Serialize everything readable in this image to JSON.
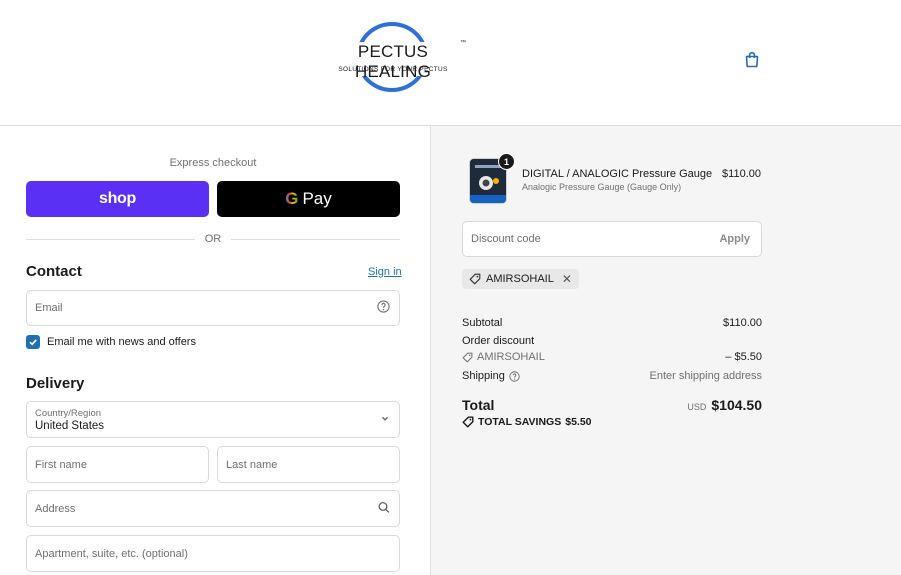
{
  "header": {
    "logo_title": "PECTUS HEALING",
    "logo_tm": "™",
    "logo_tagline": "SOLUTIONS FOR YOUR PECTUS",
    "cart_icon": "shopping-bag-icon"
  },
  "express": {
    "label": "Express checkout",
    "shop_label": "shop",
    "gpay_g": "G",
    "gpay_label": "Pay",
    "or_label": "OR"
  },
  "contact": {
    "title": "Contact",
    "signin_label": "Sign in",
    "email_placeholder": "Email",
    "newsletter_label": "Email me with news and offers",
    "newsletter_checked": true
  },
  "delivery": {
    "title": "Delivery",
    "country_label": "Country/Region",
    "country_value": "United States",
    "first_name_placeholder": "First name",
    "last_name_placeholder": "Last name",
    "address_placeholder": "Address",
    "apartment_placeholder": "Apartment, suite, etc. (optional)"
  },
  "summary": {
    "product": {
      "name": "DIGITAL / ANALOGIC Pressure Gauge",
      "variant": "Analogic Pressure Gauge (Gauge Only)",
      "price": "$110.00",
      "quantity": "1"
    },
    "discount_placeholder": "Discount code",
    "apply_label": "Apply",
    "applied_code": "AMIRSOHAIL",
    "subtotal_label": "Subtotal",
    "subtotal_value": "$110.00",
    "order_discount_label": "Order discount",
    "discount_code": "AMIRSOHAIL",
    "discount_value": "– $5.50",
    "shipping_label": "Shipping",
    "shipping_value": "Enter shipping address",
    "total_label": "Total",
    "currency": "USD",
    "total_value": "$104.50",
    "savings_label": "TOTAL SAVINGS",
    "savings_value": "$5.50"
  },
  "colors": {
    "shop_purple": "#5a31f4",
    "link_blue": "#1f6fb5",
    "logo_blue": "#2e6fd8"
  }
}
